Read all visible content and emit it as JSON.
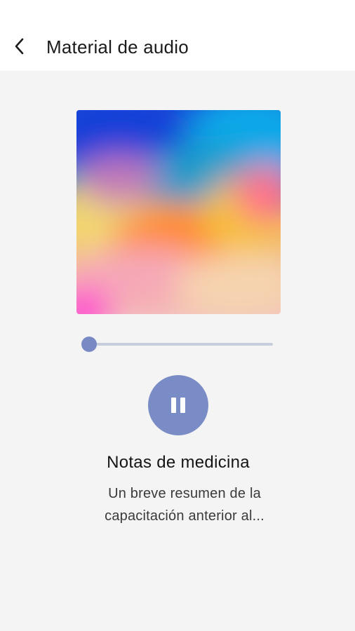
{
  "header": {
    "title": "Material de audio",
    "back_icon": "chevron-left-icon"
  },
  "player": {
    "artwork_alt": "",
    "progress": 0.0,
    "state": "playing",
    "control_icon": "pause-icon",
    "accent_color": "#7a8cc6",
    "track_color": "#c6cede"
  },
  "track": {
    "title": "Notas de medicina",
    "description_line1": "Un breve resumen de la",
    "description_line2": "capacitación anterior al..."
  }
}
